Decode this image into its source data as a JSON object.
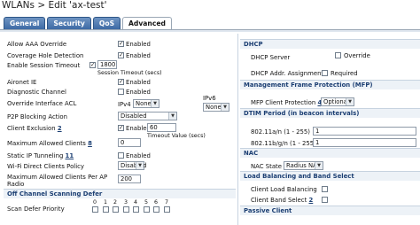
{
  "title": "WLANs > Edit  'ax-test'",
  "tabs": [
    "General",
    "Security",
    "QoS",
    "Advanced"
  ],
  "left": {
    "allow_aaa_label": "Allow AAA Override",
    "allow_aaa_value": "Enabled",
    "coverage_hole_label": "Coverage Hole Detection",
    "coverage_hole_value": "Enabled",
    "session_timeout_label": "Enable Session Timeout",
    "session_timeout_value": "1800",
    "session_timeout_unit": "Session Timeout (secs)",
    "aironet_label": "Aironet IE",
    "aironet_value": "Enabled",
    "diag_label": "Diagnostic Channel",
    "diag_value": "Enabled",
    "override_acl_label": "Override Interface ACL",
    "ipv4_label": "IPv4",
    "ipv4_value": "None",
    "ipv6_label": "IPv6",
    "ipv6_value": "None",
    "p2p_label": "P2P Blocking Action",
    "p2p_value": "Disabled",
    "client_excl_label": "Client Exclusion",
    "client_excl_note": "2",
    "client_excl_value": "Enabled",
    "timeout_value": "60",
    "timeout_unit": "Timeout Value (secs)",
    "max_clients_label": "Maximum Allowed Clients",
    "max_clients_note": "8",
    "max_clients_value": "0",
    "static_ip_label": "Static IP Tunneling",
    "static_ip_note": "11",
    "static_ip_value": "Enabled",
    "wifi_direct_label": "Wi-Fi Direct Clients Policy",
    "wifi_direct_value": "Disabled",
    "max_per_ap_label_1": "Maximum Allowed Clients Per AP",
    "max_per_ap_label_2": "Radio",
    "max_per_ap_value": "200",
    "off_channel_header": "Off Channel Scanning Defer",
    "scan_priority_label": "Scan Defer Priority",
    "scan_digits": [
      "0",
      "1",
      "2",
      "3",
      "4",
      "5",
      "6",
      "7"
    ]
  },
  "right": {
    "dhcp_header": "DHCP",
    "dhcp_server_label": "DHCP Server",
    "dhcp_server_value": "Override",
    "dhcp_assign_label": "DHCP Addr. Assignment",
    "dhcp_assign_value": "Required",
    "mfp_header": "Management Frame Protection (MFP)",
    "mfp_label": "MFP Client Protection",
    "mfp_note": "4",
    "mfp_value": "Optional",
    "dtim_header": "DTIM Period (in beacon intervals)",
    "dtim_a_label": "802.11a/n (1 - 255)",
    "dtim_a_value": "1",
    "dtim_b_label": "802.11b/g/n (1 - 255)",
    "dtim_b_value": "1",
    "nac_header": "NAC",
    "nac_label": "NAC State",
    "nac_value": "Radius NAC",
    "lb_header": "Load Balancing and Band Select",
    "lb_label": "Client Load Balancing",
    "band_label": "Client Band Select",
    "band_note": "2",
    "passive_header": "Passive Client"
  }
}
